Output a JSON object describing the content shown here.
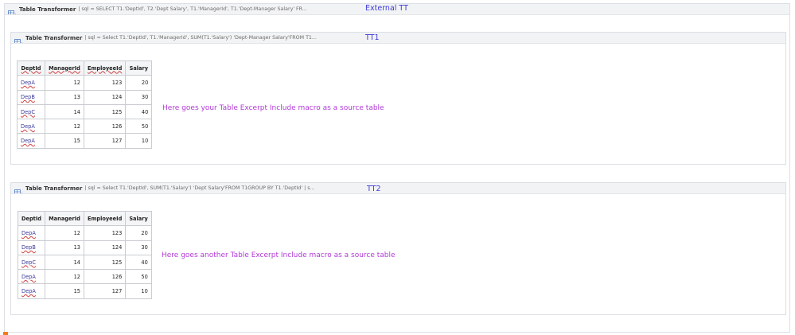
{
  "external": {
    "macro_name": "Table Transformer",
    "params": "| sql = SELECT T1.'DeptId', T2.'Dept Salary', T1.'ManagerId', T1.'Dept-Manager Salary' FR...",
    "label": "External TT"
  },
  "tt1": {
    "macro_name": "Table Transformer",
    "params": "| sql = Select T1.'DeptId', T1.'ManagerId', SUM(T1.'Salary') 'Dept-Manager Salary'FROM T1...",
    "label": "TT1",
    "placeholder": "Here goes your Table Excerpt Include macro as a source table",
    "columns": [
      "DeptId",
      "ManagerId",
      "EmployeeId",
      "Salary"
    ],
    "rows": [
      [
        "DepA",
        "12",
        "123",
        "20"
      ],
      [
        "DepB",
        "13",
        "124",
        "30"
      ],
      [
        "DepC",
        "14",
        "125",
        "40"
      ],
      [
        "DepA",
        "12",
        "126",
        "50"
      ],
      [
        "DepA",
        "15",
        "127",
        "10"
      ]
    ]
  },
  "tt2": {
    "macro_name": "Table Transformer",
    "params": "| sql = Select T1.'DeptId', SUM(T1.'Salary') 'Dept Salary'FROM T1GROUP BY T1.'DeptId' | s...",
    "label": "TT2",
    "placeholder": "Here goes another Table Excerpt Include macro as a source table",
    "columns": [
      "DeptId",
      "ManagerId",
      "EmployeeId",
      "Salary"
    ],
    "rows": [
      [
        "DepA",
        "12",
        "123",
        "20"
      ],
      [
        "DepB",
        "13",
        "124",
        "30"
      ],
      [
        "DepC",
        "14",
        "125",
        "40"
      ],
      [
        "DepA",
        "12",
        "126",
        "50"
      ],
      [
        "DepA",
        "15",
        "127",
        "10"
      ]
    ]
  },
  "icons": {
    "macro": "table-transformer-icon"
  },
  "colors": {
    "label": "#3c3cd8",
    "placeholder": "#b23bd6",
    "link": "#3b3b9e"
  }
}
